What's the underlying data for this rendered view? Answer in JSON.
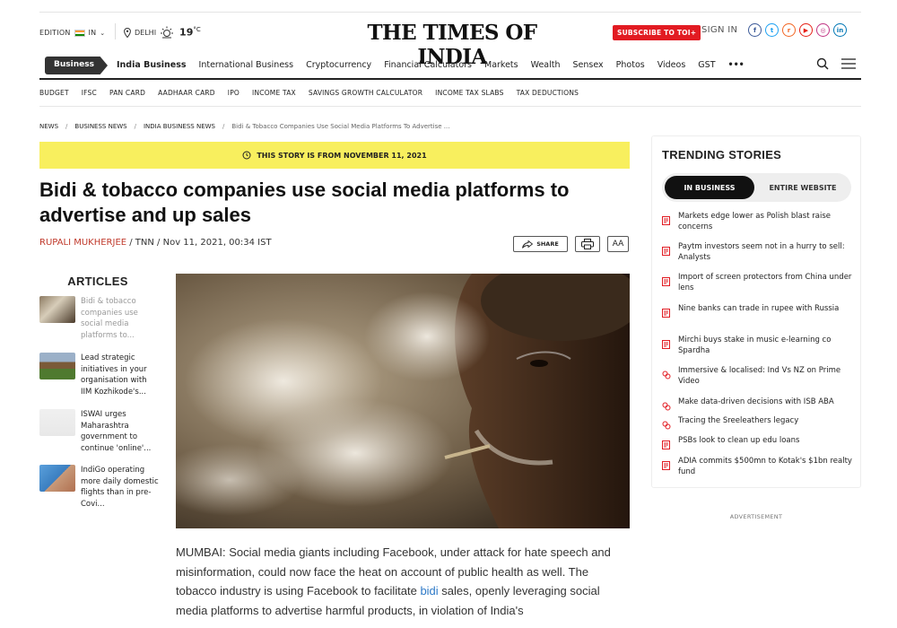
{
  "header": {
    "edition_label": "EDITION",
    "edition_value": "IN",
    "city": "DELHI",
    "temperature": "19",
    "temp_unit": "°C",
    "logo": "THE TIMES OF INDIA",
    "subscribe": "SUBSCRIBE TO TOI+",
    "signin": "SIGN IN",
    "social": [
      {
        "icon": "facebook-icon",
        "glyph": "f",
        "color": "#3b5998"
      },
      {
        "icon": "twitter-icon",
        "glyph": "t",
        "color": "#1da1f2"
      },
      {
        "icon": "rss-icon",
        "glyph": "r",
        "color": "#f26522"
      },
      {
        "icon": "youtube-icon",
        "glyph": "▶",
        "color": "#e62117"
      },
      {
        "icon": "instagram-icon",
        "glyph": "◎",
        "color": "#c13584"
      },
      {
        "icon": "linkedin-icon",
        "glyph": "in",
        "color": "#0077b5"
      }
    ]
  },
  "nav": {
    "section": "Business",
    "items": [
      "India Business",
      "International Business",
      "Cryptocurrency",
      "Financial Calculators",
      "Markets",
      "Wealth",
      "Sensex",
      "Photos",
      "Videos",
      "GST"
    ],
    "more": "•••"
  },
  "subnav": [
    "BUDGET",
    "IFSC",
    "PAN CARD",
    "AADHAAR CARD",
    "IPO",
    "INCOME TAX",
    "SAVINGS GROWTH CALCULATOR",
    "INCOME TAX SLABS",
    "TAX DEDUCTIONS"
  ],
  "breadcrumb": [
    "NEWS",
    "BUSINESS NEWS",
    "INDIA BUSINESS NEWS",
    "Bidi & Tobacco Companies Use Social Media Platforms To Advertise ..."
  ],
  "story_banner": "THIS STORY IS FROM NOVEMBER 11, 2021",
  "article": {
    "headline": "Bidi & tobacco companies use social media platforms to advertise and up sales",
    "author": "Rupali Mukherjee",
    "byline_rest": " / TNN / Nov 11, 2021, 00:34 IST",
    "share": "SHARE",
    "font_size_btn": "AA",
    "body_1": "MUMBAI: Social media giants including Facebook, under attack for hate speech and misinformation, could now face the heat on account of public health as well. The tobacco industry is using Facebook to facilitate ",
    "body_link": "bidi",
    "body_2": " sales, openly leveraging social media platforms to advertise harmful products, in violation of India's"
  },
  "articles_sidebar": {
    "title": "ARTICLES",
    "items": [
      {
        "text": "Bidi & tobacco companies use social media platforms to...",
        "dim": true
      },
      {
        "text": "Lead strategic initiatives in your organisation with IIM Kozhikode's...",
        "dim": false
      },
      {
        "text": "ISWAI urges Maharashtra government to continue 'online'...",
        "dim": false
      },
      {
        "text": "IndiGo operating more daily domestic flights than in pre-Covi...",
        "dim": false
      }
    ]
  },
  "trending": {
    "title": "TRENDING STORIES",
    "tab_active": "IN BUSINESS",
    "tab_inactive": "ENTIRE WEBSITE",
    "items": [
      {
        "text": "Markets edge lower as Polish blast raise concerns",
        "icon": "article-icon"
      },
      {
        "text": "Paytm investors seem not in a hurry to sell: Analysts",
        "icon": "article-icon"
      },
      {
        "text": "Import of screen protectors from China under lens",
        "icon": "article-icon"
      },
      {
        "text": "Nine banks can trade in rupee with Russia",
        "icon": "article-icon"
      },
      {
        "text": "Mirchi buys stake in music e-learning co Spardha",
        "icon": "article-icon"
      },
      {
        "text": "Immersive & localised: Ind Vs NZ on Prime Video",
        "icon": "brand-icon"
      },
      {
        "text": "Make data-driven decisions with ISB ABA",
        "icon": "brand-icon"
      },
      {
        "text": "Tracing the Sreeleathers legacy",
        "icon": "brand-icon"
      },
      {
        "text": "PSBs look to clean up edu loans",
        "icon": "article-icon"
      },
      {
        "text": "ADIA commits $500mn to Kotak's $1bn realty fund",
        "icon": "article-icon"
      }
    ]
  },
  "advertisement": "ADVERTISEMENT",
  "colors": {
    "accent": "#e21b22",
    "banner": "#f8ef5e",
    "author": "#c0392b",
    "link": "#2d79c7"
  }
}
